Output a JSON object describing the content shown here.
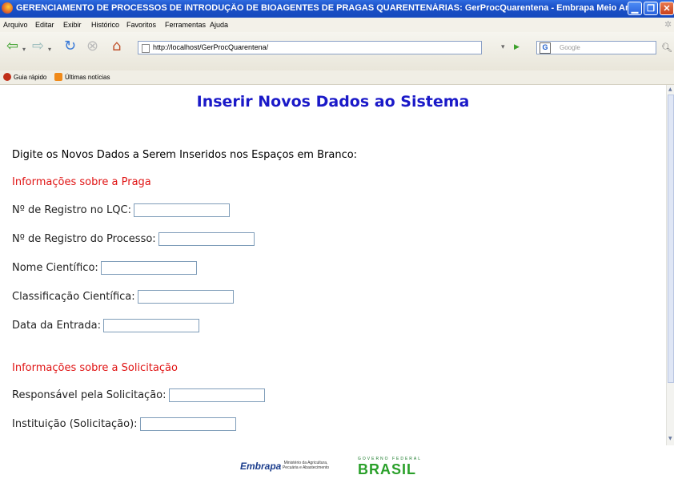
{
  "window": {
    "title": "GERENCIAMENTO DE PROCESSOS DE INTRODUÇÃO DE BIOAGENTES DE PRAGAS QUARENTENÁRIAS: GerProcQuarentena - Embrapa Meio Ambiente - Mozi..."
  },
  "menu": [
    "Arquivo",
    "Editar",
    "Exibir",
    "Histórico",
    "Favoritos",
    "Ferramentas",
    "Ajuda"
  ],
  "nav": {
    "url": "http://localhost/GerProcQuarentena/",
    "search_placeholder": "Google"
  },
  "bookmarks": [
    "Guia rápido",
    "Últimas notícias"
  ],
  "page": {
    "heading": "Inserir Novos Dados ao Sistema",
    "intro": "Digite os Novos Dados a Serem Inseridos nos Espaços em Branco:",
    "section_praga": "Informações sobre a Praga",
    "praga_fields": [
      "Nº de Registro no LQC:",
      "Nº de Registro do Processo:",
      "Nome Científico:",
      "Classificação Científica:",
      "Data da Entrada:"
    ],
    "section_solicitacao": "Informações sobre a Solicitação",
    "solicitacao_fields": [
      "Responsável pela Solicitação:",
      "Instituição (Solicitação):"
    ]
  },
  "footer": {
    "embrapa": "Embrapa",
    "ministerio": "Ministério da Agricultura, Pecuária e Abastecimento",
    "gov": "GOVERNO FEDERAL",
    "brasil": "BRASIL"
  },
  "colors": {
    "heading": "#1a19c8",
    "section": "#e01414",
    "titlebar": "#1a50c8"
  }
}
